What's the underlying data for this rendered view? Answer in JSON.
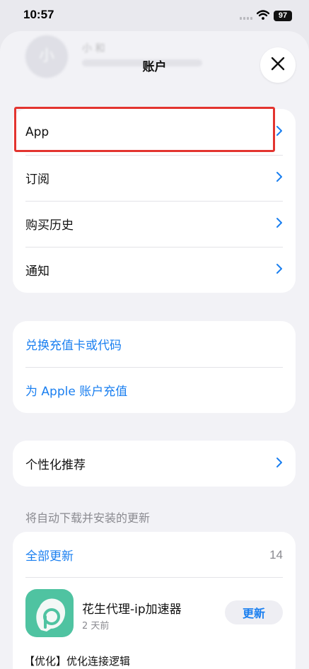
{
  "status": {
    "time": "10:57",
    "battery": "97"
  },
  "profile": {
    "avatar_letter": "小",
    "name": "小 和"
  },
  "sheet": {
    "title": "账户"
  },
  "menu1": {
    "items": [
      {
        "label": "App"
      },
      {
        "label": "订阅"
      },
      {
        "label": "购买历史"
      },
      {
        "label": "通知"
      }
    ]
  },
  "menu2": {
    "items": [
      {
        "label": "兑换充值卡或代码"
      },
      {
        "label": "为 Apple 账户充值"
      }
    ]
  },
  "menu3": {
    "personalized": "个性化推荐"
  },
  "updates": {
    "header": "将自动下载并安装的更新",
    "update_all": "全部更新",
    "count": "14",
    "app": {
      "name": "花生代理-ip加速器",
      "time": "2 天前",
      "button": "更新",
      "notes": "【优化】优化连接逻辑"
    }
  },
  "colors": {
    "accent": "#1a7ff0",
    "highlight": "#e3342f",
    "app_icon": "#4fc3a1"
  }
}
